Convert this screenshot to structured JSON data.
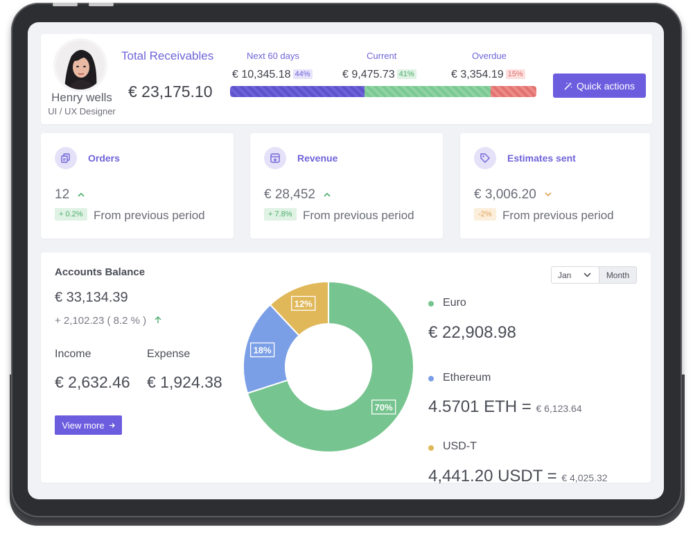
{
  "profile": {
    "name": "Henry wells",
    "role": "UI / UX Designer"
  },
  "receivables": {
    "title": "Total Receivables",
    "total": "€ 23,175.10",
    "segments": [
      {
        "label": "Next 60 days",
        "value": "€ 10,345.18",
        "percent": "44%",
        "share": 44
      },
      {
        "label": "Current",
        "value": "€ 9,475.73",
        "percent": "41%",
        "share": 41
      },
      {
        "label": "Overdue",
        "value": "€ 3,354.19",
        "percent": "15%",
        "share": 15
      }
    ]
  },
  "quick_actions_label": "Quick actions",
  "stats": [
    {
      "title": "Orders",
      "value": "12",
      "change": "+ 0.2%",
      "trend": "up",
      "note": "From previous period",
      "icon": "copy-icon"
    },
    {
      "title": "Revenue",
      "value": "€ 28,452",
      "change": "+ 7.8%",
      "trend": "up",
      "note": "From previous period",
      "icon": "archive-icon"
    },
    {
      "title": "Estimates sent",
      "value": "€ 3,006.20",
      "change": "-2%",
      "trend": "down",
      "note": "From previous period",
      "icon": "tag-icon"
    }
  ],
  "balance": {
    "title": "Accounts Balance",
    "total": "€ 33,134.39",
    "change": "+ 2,102.23 ( 8.2 % )",
    "income_label": "Income",
    "income_value": "€ 2,632.46",
    "expense_label": "Expense",
    "expense_value": "€ 1,924.38",
    "view_more": "View more",
    "period_select": "Jan",
    "period_button": "Month"
  },
  "legend": [
    {
      "name": "Euro",
      "value": "€ 22,908.98",
      "sub": "",
      "color": "#76c48f"
    },
    {
      "name": "Ethereum",
      "value": "4.5701 ETH =",
      "sub": "€ 6,123.64",
      "color": "#7b9fe6"
    },
    {
      "name": "USD-T",
      "value": "4,441.20 USDT =",
      "sub": "€ 4,025.32",
      "color": "#e0b85a"
    }
  ],
  "chart_data": {
    "type": "pie",
    "categories": [
      "Euro",
      "Ethereum",
      "USD-T"
    ],
    "values": [
      70,
      18,
      12
    ],
    "labels": [
      "70%",
      "18%",
      "12%"
    ],
    "colors": [
      "#76c48f",
      "#7b9fe6",
      "#e0b85a"
    ]
  }
}
